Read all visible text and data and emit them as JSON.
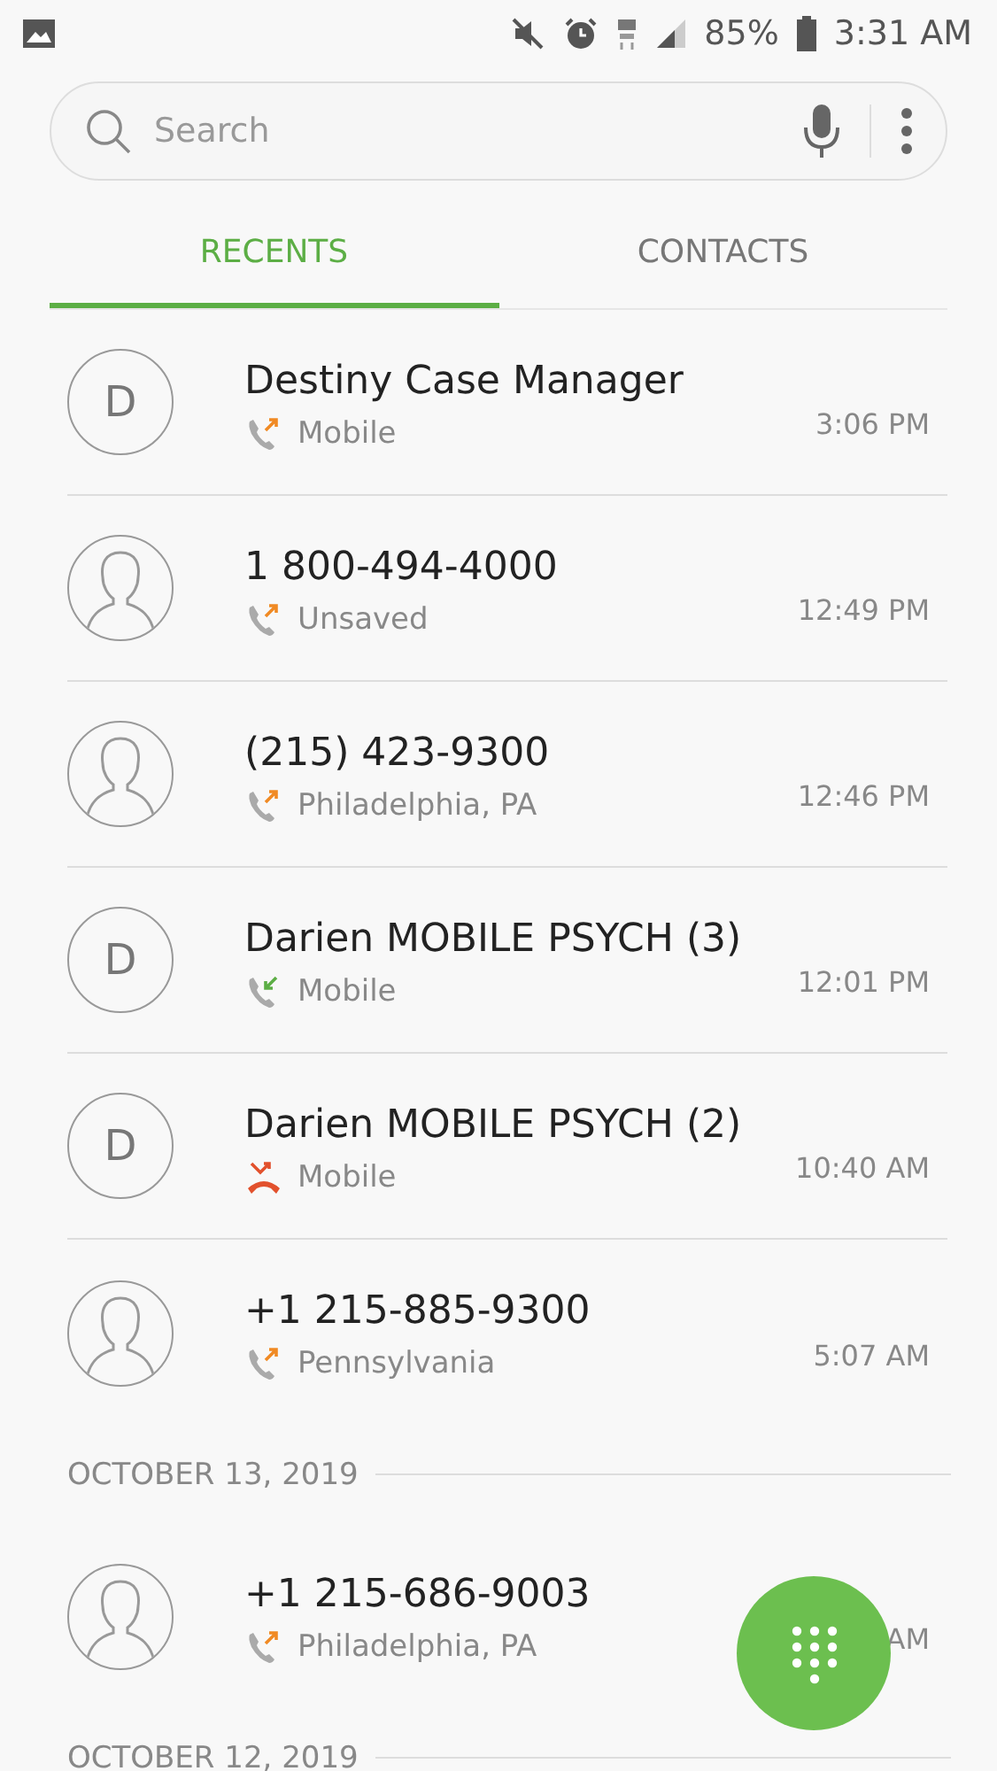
{
  "status_bar": {
    "battery": "85%",
    "time": "3:31 AM"
  },
  "search": {
    "placeholder": "Search"
  },
  "tabs": [
    {
      "label": "RECENTS",
      "selected": true
    },
    {
      "label": "CONTACTS",
      "selected": false
    }
  ],
  "log": [
    {
      "kind": "call",
      "avatar": {
        "kind": "letter",
        "letter": "D"
      },
      "name": "Destiny Case Manager",
      "call": {
        "kind": "outgoing"
      },
      "detail": "Mobile",
      "time": "3:06 PM"
    },
    {
      "kind": "call",
      "avatar": {
        "kind": "person"
      },
      "name": "1 800-494-4000",
      "call": {
        "kind": "outgoing"
      },
      "detail": "Unsaved",
      "time": "12:49 PM"
    },
    {
      "kind": "call",
      "avatar": {
        "kind": "person"
      },
      "name": "(215) 423-9300",
      "call": {
        "kind": "outgoing"
      },
      "detail": "Philadelphia, PA",
      "time": "12:46 PM"
    },
    {
      "kind": "call",
      "avatar": {
        "kind": "letter",
        "letter": "D"
      },
      "name": "Darien MOBILE PSYCH (3)",
      "call": {
        "kind": "incoming"
      },
      "detail": "Mobile",
      "time": "12:01 PM"
    },
    {
      "kind": "call",
      "avatar": {
        "kind": "letter",
        "letter": "D"
      },
      "name": "Darien MOBILE PSYCH (2)",
      "call": {
        "kind": "missed"
      },
      "detail": "Mobile",
      "time": "10:40 AM"
    },
    {
      "kind": "call",
      "avatar": {
        "kind": "person"
      },
      "name": "+1 215-885-9300",
      "call": {
        "kind": "outgoing"
      },
      "detail": "Pennsylvania",
      "time": "5:07 AM"
    },
    {
      "kind": "date",
      "label": "OCTOBER 13, 2019"
    },
    {
      "kind": "call",
      "avatar": {
        "kind": "person"
      },
      "name": "+1 215-686-9003",
      "call": {
        "kind": "outgoing"
      },
      "detail": "Philadelphia, PA",
      "time": "AM"
    },
    {
      "kind": "date",
      "label": "OCTOBER 12, 2019"
    }
  ]
}
